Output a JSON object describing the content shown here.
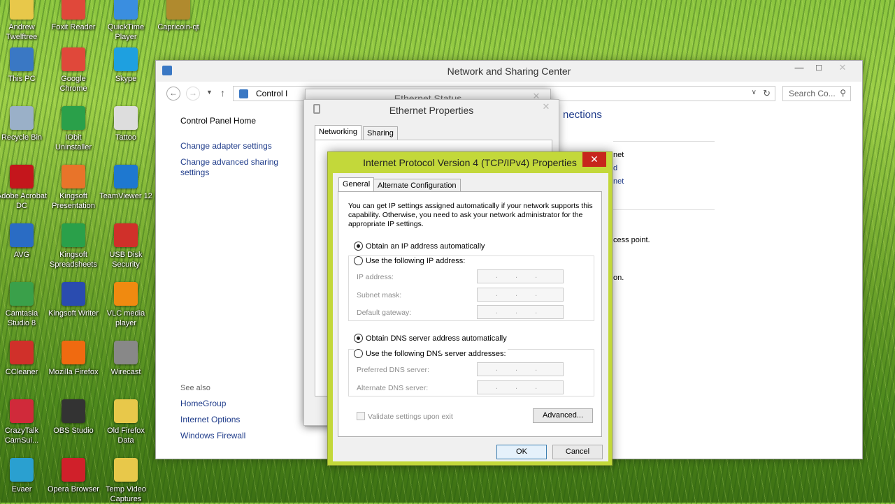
{
  "desktop": {
    "icons": [
      {
        "label": "Andrew Twelftree",
        "icon": "user-folder-icon",
        "color": "#e8c84a"
      },
      {
        "label": "Foxit Reader",
        "icon": "foxit-icon",
        "color": "#e0483a"
      },
      {
        "label": "QuickTime Player",
        "icon": "quicktime-icon",
        "color": "#3a8ee0"
      },
      {
        "label": "Capricoin-qt",
        "icon": "capricoin-icon",
        "color": "#b08a2e"
      },
      {
        "label": "This PC",
        "icon": "computer-icon",
        "color": "#3a78c4"
      },
      {
        "label": "Google Chrome",
        "icon": "chrome-icon",
        "color": "#e0483a"
      },
      {
        "label": "Skype",
        "icon": "skype-icon",
        "color": "#1ea0e0"
      },
      {
        "label": "Recycle Bin",
        "icon": "recycle-bin-icon",
        "color": "#9ab0c8"
      },
      {
        "label": "IObit Uninstaller",
        "icon": "iobit-icon",
        "color": "#2aa04a"
      },
      {
        "label": "Tattoo",
        "icon": "shortcut-icon",
        "color": "#dddddd"
      },
      {
        "label": "Adobe Acrobat DC",
        "icon": "acrobat-icon",
        "color": "#c4161c"
      },
      {
        "label": "Kingsoft Presentation",
        "icon": "kingsoft-presentation-icon",
        "color": "#e8742a"
      },
      {
        "label": "TeamViewer 12",
        "icon": "teamviewer-icon",
        "color": "#1e78d0"
      },
      {
        "label": "AVG",
        "icon": "avg-icon",
        "color": "#2a6cc4"
      },
      {
        "label": "Kingsoft Spreadsheets",
        "icon": "kingsoft-spreadsheets-icon",
        "color": "#2aa04a"
      },
      {
        "label": "USB Disk Security",
        "icon": "usb-security-icon",
        "color": "#d0302a"
      },
      {
        "label": "Camtasia Studio 8",
        "icon": "camtasia-icon",
        "color": "#3aa04a"
      },
      {
        "label": "Kingsoft Writer",
        "icon": "kingsoft-writer-icon",
        "color": "#2a4cb0"
      },
      {
        "label": "VLC media player",
        "icon": "vlc-icon",
        "color": "#f08a10"
      },
      {
        "label": "CCleaner",
        "icon": "ccleaner-icon",
        "color": "#d0302a"
      },
      {
        "label": "Mozilla Firefox",
        "icon": "firefox-icon",
        "color": "#f06a10"
      },
      {
        "label": "Wirecast",
        "icon": "wirecast-icon",
        "color": "#888888"
      },
      {
        "label": "CrazyTalk CamSui...",
        "icon": "crazytalk-icon",
        "color": "#d02a3a"
      },
      {
        "label": "OBS Studio",
        "icon": "obs-icon",
        "color": "#333333"
      },
      {
        "label": "Old Firefox Data",
        "icon": "folder-icon",
        "color": "#e8c84a"
      },
      {
        "label": "Evaer",
        "icon": "evaer-icon",
        "color": "#2aa0d0"
      },
      {
        "label": "Opera Browser",
        "icon": "opera-icon",
        "color": "#d0202a"
      },
      {
        "label": "Temp Video Captures",
        "icon": "folder-icon",
        "color": "#e8c84a"
      }
    ]
  },
  "nsc_window": {
    "title": "Network and Sharing Center",
    "address": "Control I",
    "search_placeholder": "Search Co...",
    "left_links": {
      "home": "Control Panel Home",
      "adapter": "Change adapter settings",
      "advanced": "Change advanced sharing settings"
    },
    "see_also": {
      "heading": "See also",
      "homegroup": "HomeGroup",
      "internet_options": "Internet Options",
      "firewall": "Windows Firewall"
    },
    "visible_fragments": {
      "heading": "nections",
      "line1": "net",
      "line2": "d",
      "line3": "net",
      "access_point": "cess point.",
      "on": "on."
    }
  },
  "ethernet_status": {
    "title": "Ethernet Status"
  },
  "ethernet_properties": {
    "title": "Ethernet Properties",
    "tabs": [
      "Networking",
      "Sharing"
    ]
  },
  "ipv4_dialog": {
    "title": "Internet Protocol Version 4 (TCP/IPv4) Properties",
    "tabs": [
      "General",
      "Alternate Configuration"
    ],
    "description": "You can get IP settings assigned automatically if your network supports this capability. Otherwise, you need to ask your network administrator for the appropriate IP settings.",
    "ip_auto_label": "Obtain an IP address automatically",
    "ip_manual_label": "Use the following IP address:",
    "ip_fields": {
      "ip_address": "IP address:",
      "subnet_mask": "Subnet mask:",
      "default_gateway": "Default gateway:"
    },
    "ip_placeholder": ". . .",
    "dns_auto_label": "Obtain DNS server address automatically",
    "dns_manual_label": "Use the following DNS server addresses:",
    "dns_fields": {
      "preferred": "Preferred DNS server:",
      "alternate": "Alternate DNS server:"
    },
    "validate_label": "Validate settings upon exit",
    "advanced_button": "Advanced...",
    "ok_button": "OK",
    "cancel_button": "Cancel",
    "ip_mode": "automatic",
    "dns_mode": "automatic"
  }
}
